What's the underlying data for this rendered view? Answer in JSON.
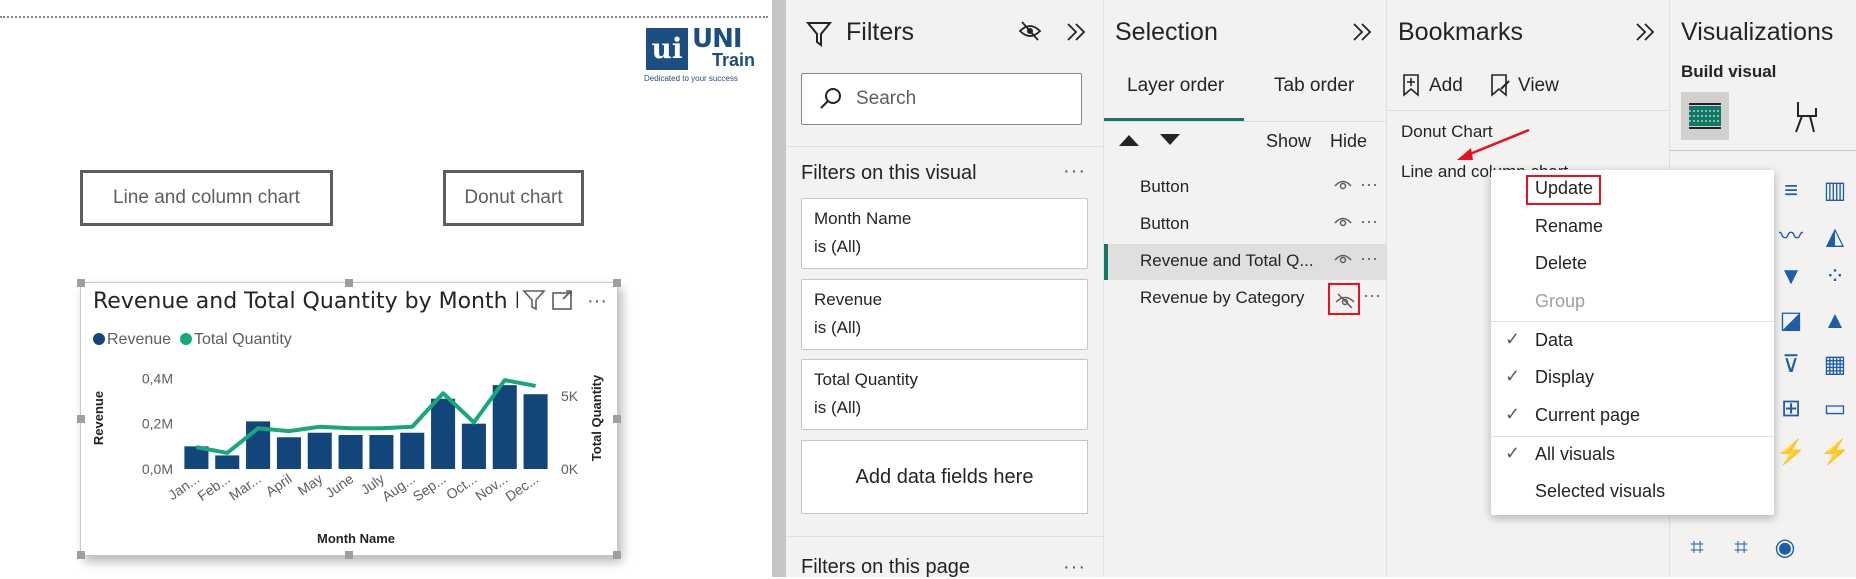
{
  "canvas": {
    "logo": {
      "mark": "ui",
      "uni": "UNI",
      "train": "Train",
      "tagline": "Dedicated to your success"
    },
    "buttons": {
      "line_and_column": "Line and column chart",
      "donut": "Donut chart"
    },
    "visual": {
      "title": "Revenue and Total Quantity by Month N",
      "legend": [
        {
          "name": "Revenue",
          "color": "#12467b"
        },
        {
          "name": "Total Quantity",
          "color": "#16a77d"
        }
      ],
      "icons": [
        "filter-icon",
        "focus-mode-icon",
        "more-options-icon"
      ],
      "header_more": "···"
    }
  },
  "chart_data": {
    "type": "bar",
    "title": "Revenue and Total Quantity by Month N",
    "xlabel": "Month Name",
    "ylabel": "Revenue",
    "y2label": "Total Quantity",
    "categories": [
      "Jan...",
      "Feb...",
      "Mar...",
      "April",
      "May",
      "June",
      "July",
      "Aug...",
      "Sep...",
      "Oct...",
      "Nov...",
      "Dec..."
    ],
    "yticks": [
      "0,4M",
      "0,2M",
      "0,0M"
    ],
    "y2ticks": [
      "5K",
      "0K"
    ],
    "ylim": [
      0,
      0.45
    ],
    "y2lim": [
      0,
      7
    ],
    "series": [
      {
        "name": "Revenue",
        "kind": "bar",
        "color": "#12467b",
        "values": [
          0.1,
          0.06,
          0.21,
          0.14,
          0.16,
          0.15,
          0.15,
          0.16,
          0.31,
          0.2,
          0.37,
          0.33
        ]
      },
      {
        "name": "Total Quantity",
        "kind": "line",
        "color": "#16a77d",
        "values": [
          1.5,
          1.1,
          2.8,
          2.6,
          2.9,
          2.8,
          2.8,
          2.9,
          5.2,
          3.2,
          6.1,
          5.7
        ]
      }
    ],
    "grid": false,
    "legend": "top-left"
  },
  "filters": {
    "title": "Filters",
    "search_placeholder": "Search",
    "on_visual_label": "Filters on this visual",
    "more": "···",
    "cards": [
      {
        "name": "Month Name",
        "value": "is (All)"
      },
      {
        "name": "Revenue",
        "value": "is (All)"
      },
      {
        "name": "Total Quantity",
        "value": "is (All)"
      }
    ],
    "add_fields": "Add data fields here",
    "on_page_label": "Filters on this page"
  },
  "selection": {
    "title": "Selection",
    "tabs": [
      "Layer order",
      "Tab order"
    ],
    "show": "Show",
    "hide": "Hide",
    "items": [
      "Button",
      "Button",
      "Revenue and Total Q...",
      "Revenue by Category"
    ]
  },
  "bookmarks": {
    "title": "Bookmarks",
    "add": "Add",
    "view": "View",
    "items": [
      "Donut Chart",
      "Line and column chart"
    ]
  },
  "context_menu": {
    "items": [
      "Update",
      "Rename",
      "Delete",
      "Group",
      "Data",
      "Display",
      "Current page",
      "All visuals",
      "Selected visuals"
    ]
  },
  "visualizations": {
    "title": "Visualizations",
    "build_visual": "Build visual"
  },
  "colors": {
    "accent": "#117865",
    "highlight": "#e81123",
    "revenue": "#12467b",
    "quantity": "#16a77d"
  }
}
